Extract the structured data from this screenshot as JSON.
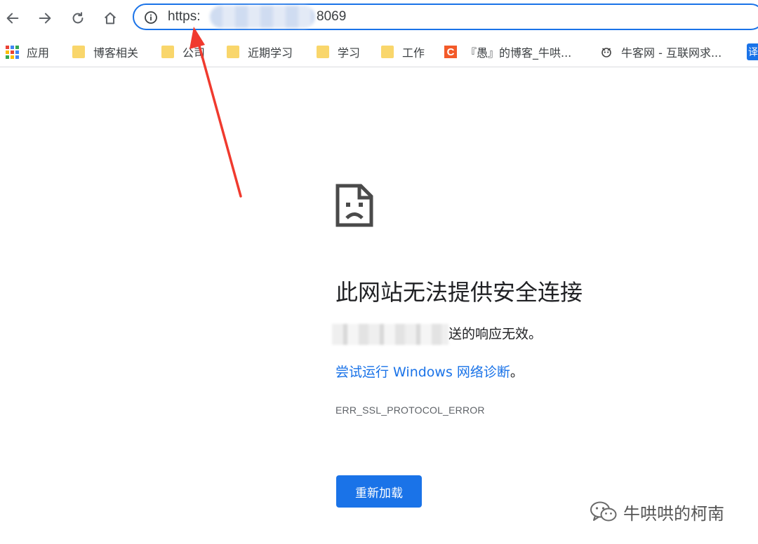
{
  "toolbar": {
    "url_scheme": "https:",
    "url_port": "8069",
    "icons": [
      "back-arrow-icon",
      "forward-arrow-icon",
      "reload-icon",
      "home-icon",
      "info-icon"
    ]
  },
  "bookmarks": [
    {
      "label": "应用",
      "icon": "apps-grid-icon"
    },
    {
      "label": "博客相关",
      "icon": "folder-icon"
    },
    {
      "label": "公司",
      "icon": "folder-icon"
    },
    {
      "label": "近期学习",
      "icon": "folder-icon"
    },
    {
      "label": "学习",
      "icon": "folder-icon"
    },
    {
      "label": "工作",
      "icon": "folder-icon"
    },
    {
      "label": "『愚』的博客_牛哄...",
      "icon": "csdn-icon"
    },
    {
      "label": "牛客网 - 互联网求...",
      "icon": "nowcoder-icon"
    },
    {
      "label": "译",
      "icon": "translate-icon"
    }
  ],
  "csdn_icon_letter": "C",
  "error": {
    "title": "此网站无法提供安全连接",
    "detail_suffix": "送的响应无效。",
    "diagnose_link": "尝试运行 Windows 网络诊断",
    "diagnose_suffix": "。",
    "code": "ERR_SSL_PROTOCOL_ERROR",
    "reload_label": "重新加载"
  },
  "watermark": {
    "text": "牛哄哄的柯南"
  },
  "colors": {
    "accent": "#1a73e8",
    "annotation_arrow": "#f03a2e",
    "folder": "#f9d66b",
    "csdn": "#f35a29"
  }
}
